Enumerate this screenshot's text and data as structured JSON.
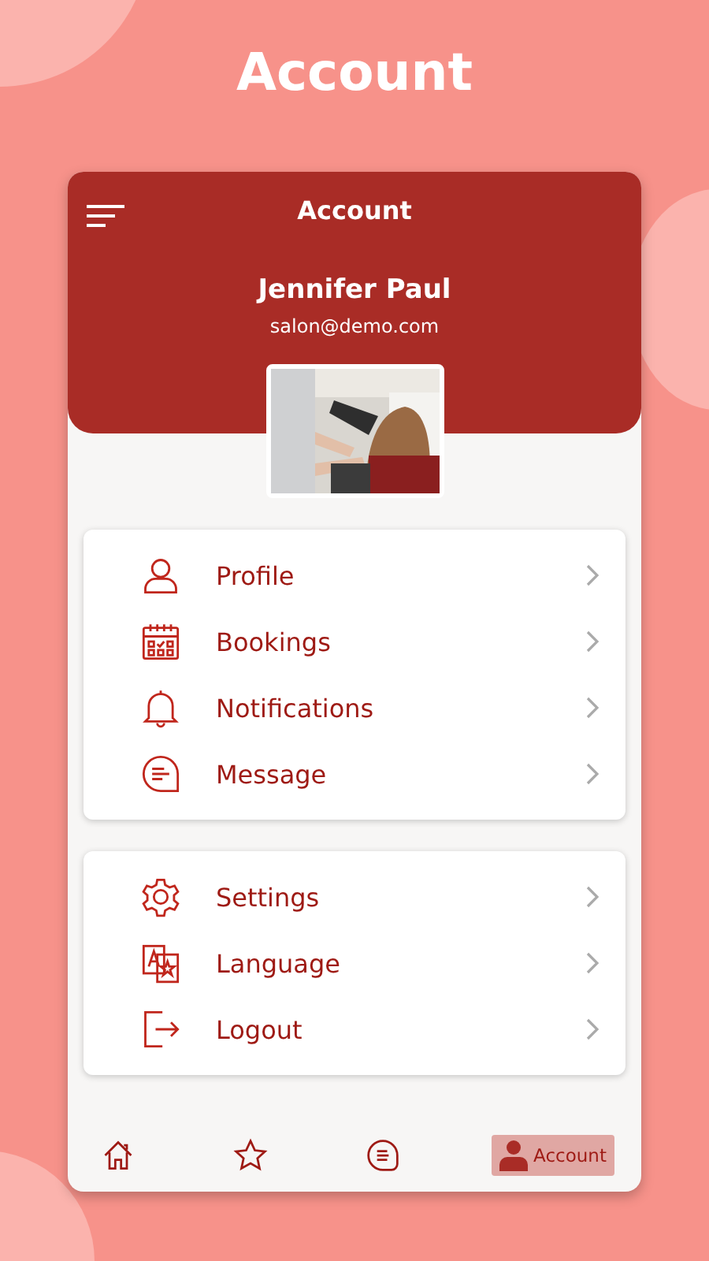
{
  "page_title": "Account",
  "header": {
    "title": "Account",
    "name": "Jennifer Paul",
    "email": "salon@demo.com"
  },
  "menu_groups": [
    {
      "items": [
        {
          "label": "Profile"
        },
        {
          "label": "Bookings"
        },
        {
          "label": "Notifications"
        },
        {
          "label": "Message"
        }
      ]
    },
    {
      "items": [
        {
          "label": "Settings"
        },
        {
          "label": "Language"
        },
        {
          "label": "Logout"
        }
      ]
    }
  ],
  "bottom_nav": [
    {
      "selected": false
    },
    {
      "selected": false
    },
    {
      "selected": false
    },
    {
      "selected": true,
      "label": "Account"
    }
  ]
}
